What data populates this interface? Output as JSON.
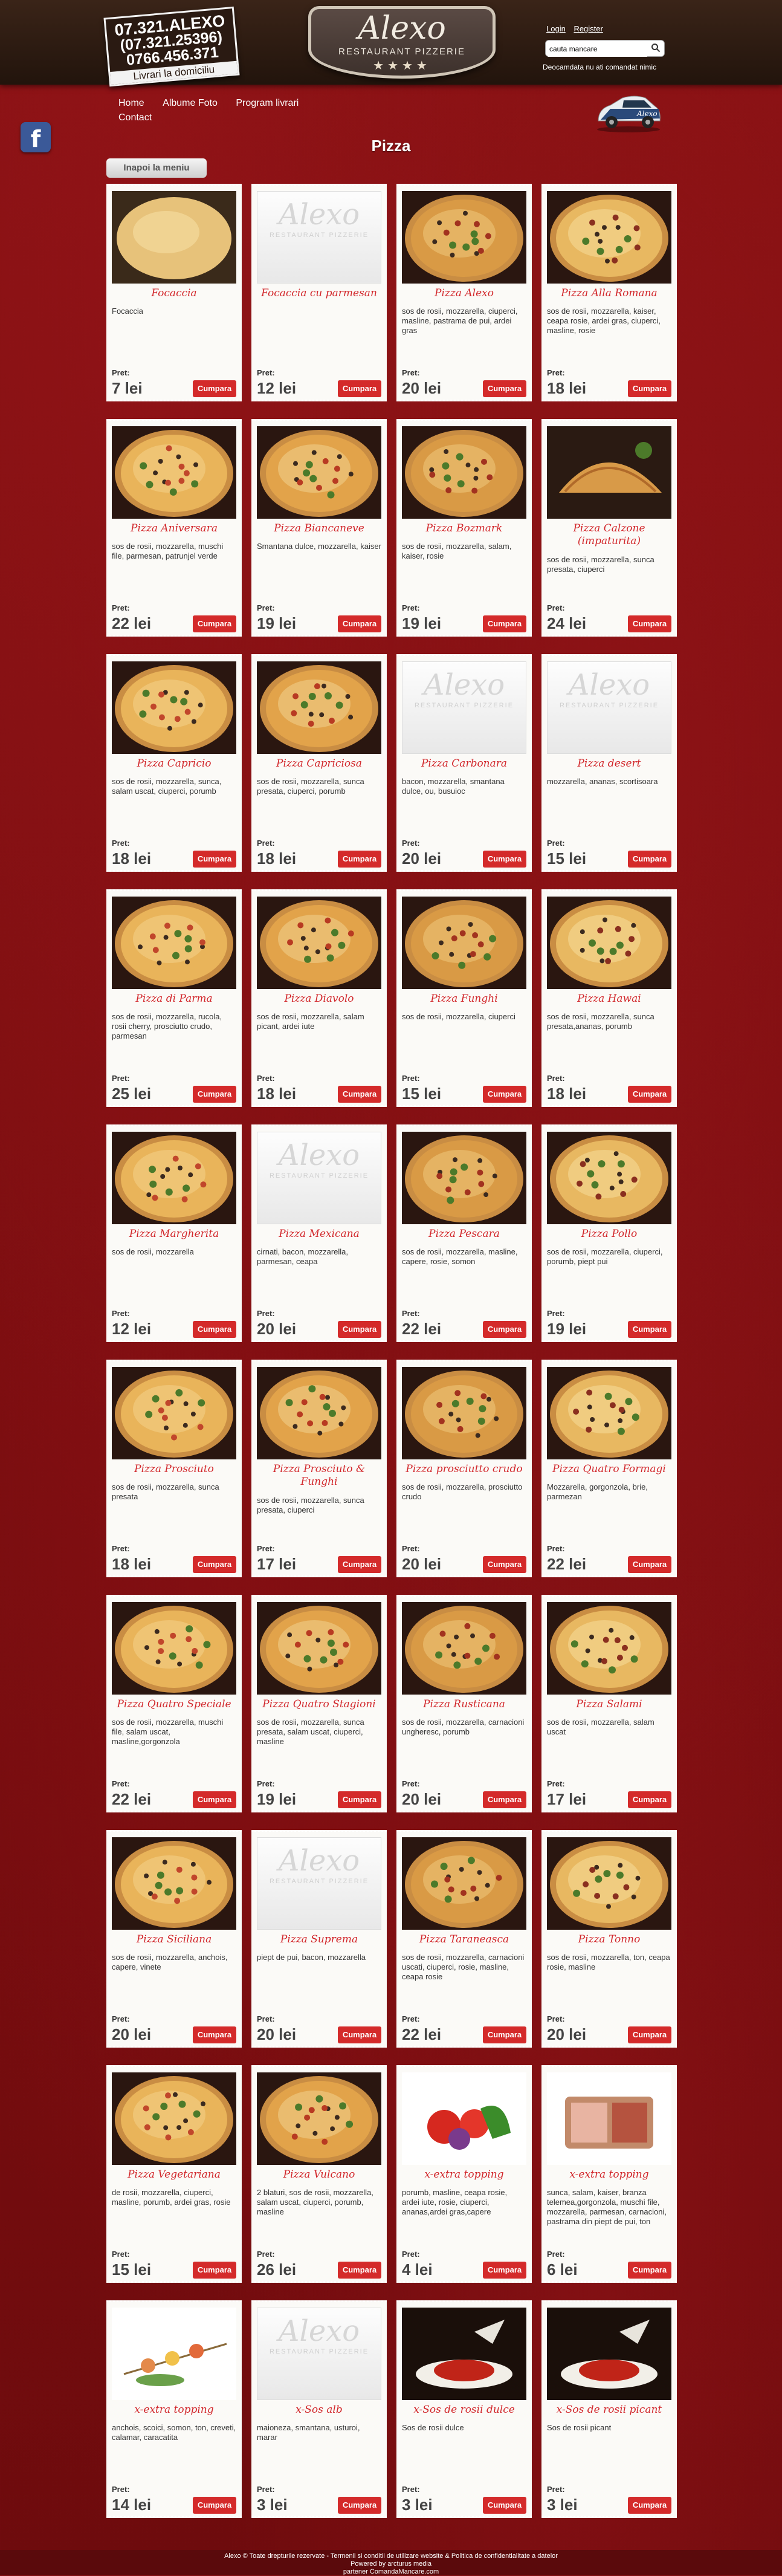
{
  "header": {
    "phone_line1": "07.321.ALEXO",
    "phone_line2": "(07.321.25396)",
    "phone_line3": "0766.456.371",
    "phone_line4": "Livrari la domiciliu",
    "logo_name": "Alexo",
    "logo_sub": "RESTAURANT PIZZERIE",
    "logo_stars": "★★★★",
    "login": "Login",
    "register": "Register",
    "search_value": "cauta mancare",
    "order_status": "Deocamdata nu ati comandat nimic",
    "car_text": "Alexo"
  },
  "nav": [
    "Home",
    "Albume Foto",
    "Program livrari",
    "Contact"
  ],
  "facebook_icon": "f",
  "page_title": "Pizza",
  "back_button": "Inapoi la meniu",
  "price_label": "Pret:",
  "buy_label": "Cumpara",
  "placeholder": {
    "name": "Alexo",
    "sub": "RESTAURANT PIZZERIE"
  },
  "colors": {
    "accent": "#d42a2a",
    "background": "#7a0e10",
    "title_red": "#d2272b"
  },
  "products": [
    {
      "name": "Focaccia",
      "desc": "Focaccia",
      "price": "7 lei",
      "img": "focaccia"
    },
    {
      "name": "Focaccia cu parmesan",
      "desc": "",
      "price": "12 lei",
      "img": "none"
    },
    {
      "name": "Pizza Alexo",
      "desc": "sos de rosii, mozzarella, ciuperci, masline, pastrama de pui, ardei gras",
      "price": "20 lei",
      "img": "pizza"
    },
    {
      "name": "Pizza Alla Romana",
      "desc": "sos de rosii, mozzarella, kaiser, ceapa rosie, ardei gras, ciuperci, masline, rosie",
      "price": "18 lei",
      "img": "pizza"
    },
    {
      "name": "Pizza Aniversara",
      "desc": "sos de rosii, mozzarella, muschi file, parmesan, patrunjel verde",
      "price": "22 lei",
      "img": "pizza"
    },
    {
      "name": "Pizza Biancaneve",
      "desc": "Smantana dulce, mozzarella, kaiser",
      "price": "19 lei",
      "img": "pizza"
    },
    {
      "name": "Pizza Bozmark",
      "desc": "sos de rosii, mozzarella, salam, kaiser, rosie",
      "price": "19 lei",
      "img": "pizza"
    },
    {
      "name": "Pizza Calzone (impaturita)",
      "desc": "sos de rosii, mozzarella, sunca presata, ciuperci",
      "price": "24 lei",
      "img": "calzone"
    },
    {
      "name": "Pizza Capricio",
      "desc": "sos de rosii, mozzarella, sunca, salam uscat, ciuperci, porumb",
      "price": "18 lei",
      "img": "pizza"
    },
    {
      "name": "Pizza Capriciosa",
      "desc": "sos de rosii, mozzarella, sunca presata, ciuperci, porumb",
      "price": "18 lei",
      "img": "pizza"
    },
    {
      "name": "Pizza Carbonara",
      "desc": "bacon, mozzarella, smantana dulce, ou, busuioc",
      "price": "20 lei",
      "img": "none"
    },
    {
      "name": "Pizza desert",
      "desc": "mozzarella, ananas, scortisoara",
      "price": "15 lei",
      "img": "none"
    },
    {
      "name": "Pizza di Parma",
      "desc": "sos de rosii, mozzarella, rucola, rosii cherry, prosciutto crudo, parmesan",
      "price": "25 lei",
      "img": "pizza"
    },
    {
      "name": "Pizza Diavolo",
      "desc": "sos de rosii, mozzarella, salam picant, ardei iute",
      "price": "18 lei",
      "img": "pizza"
    },
    {
      "name": "Pizza Funghi",
      "desc": "sos de rosii, mozzarella, ciuperci",
      "price": "15 lei",
      "img": "pizza"
    },
    {
      "name": "Pizza Hawai",
      "desc": "sos de rosii, mozzarella, sunca presata,ananas, porumb",
      "price": "18 lei",
      "img": "pizza"
    },
    {
      "name": "Pizza Margherita",
      "desc": "sos de rosii, mozzarella",
      "price": "12 lei",
      "img": "pizza"
    },
    {
      "name": "Pizza Mexicana",
      "desc": "cirnati, bacon, mozzarella, parmesan, ceapa",
      "price": "20 lei",
      "img": "none"
    },
    {
      "name": "Pizza Pescara",
      "desc": "sos de rosii, mozzarella, masline, capere, rosie, somon",
      "price": "22 lei",
      "img": "pizza"
    },
    {
      "name": "Pizza Pollo",
      "desc": "sos de rosii, mozzarella, ciuperci, porumb, piept pui",
      "price": "19 lei",
      "img": "pizza"
    },
    {
      "name": "Pizza Prosciuto",
      "desc": "sos de rosii, mozzarella, sunca presata",
      "price": "18 lei",
      "img": "pizza"
    },
    {
      "name": "Pizza Prosciuto & Funghi",
      "desc": "sos de rosii, mozzarella, sunca presata, ciuperci",
      "price": "17 lei",
      "img": "pizza"
    },
    {
      "name": "Pizza prosciutto crudo",
      "desc": "sos de rosii, mozzarella, prosciutto crudo",
      "price": "20 lei",
      "img": "pizza"
    },
    {
      "name": "Pizza Quatro Formagi",
      "desc": "Mozzarella, gorgonzola, brie, parmezan",
      "price": "22 lei",
      "img": "pizza"
    },
    {
      "name": "Pizza Quatro Speciale",
      "desc": "sos de rosii, mozzarella, muschi file, salam uscat, masline,gorgonzola",
      "price": "22 lei",
      "img": "pizza"
    },
    {
      "name": "Pizza Quatro Stagioni",
      "desc": "sos de rosii, mozzarella, sunca presata, salam uscat, ciuperci, masline",
      "price": "19 lei",
      "img": "pizza"
    },
    {
      "name": "Pizza Rusticana",
      "desc": "sos de rosii, mozzarella, carnacioni ungheresc, porumb",
      "price": "20 lei",
      "img": "pizza"
    },
    {
      "name": "Pizza Salami",
      "desc": "sos de rosii, mozzarella, salam uscat",
      "price": "17 lei",
      "img": "pizza"
    },
    {
      "name": "Pizza Siciliana",
      "desc": "sos de rosii, mozzarella, anchois, capere, vinete",
      "price": "20 lei",
      "img": "pizza"
    },
    {
      "name": "Pizza Suprema",
      "desc": "piept de pui, bacon, mozzarella",
      "price": "20 lei",
      "img": "none"
    },
    {
      "name": "Pizza Taraneasca",
      "desc": "sos de rosii, mozzarella, carnacioni uscati, ciuperci, rosie, masline, ceapa rosie",
      "price": "22 lei",
      "img": "pizza"
    },
    {
      "name": "Pizza Tonno",
      "desc": "sos de rosii, mozzarella, ton, ceapa rosie, masline",
      "price": "20 lei",
      "img": "pizza"
    },
    {
      "name": "Pizza Vegetariana",
      "desc": "de rosii, mozzarella, ciuperci, masline, porumb, ardei gras, rosie",
      "price": "15 lei",
      "img": "pizza"
    },
    {
      "name": "Pizza Vulcano",
      "desc": "2 blaturi, sos de rosii, mozzarella, salam uscat, ciuperci, porumb, masline",
      "price": "26 lei",
      "img": "pizza"
    },
    {
      "name": "x-extra topping",
      "desc": "porumb, masline, ceapa rosie, ardei iute, rosie, ciuperci, ananas,ardei gras,capere",
      "price": "4 lei",
      "img": "vegetables"
    },
    {
      "name": "x-extra topping",
      "desc": "sunca, salam, kaiser, branza telemea,gorgonzola, muschi file, mozzarella, parmesan, carnacioni, pastrama din piept de pui, ton",
      "price": "6 lei",
      "img": "meats"
    },
    {
      "name": "x-extra topping",
      "desc": "anchois, scoici, somon, ton, creveti, calamar, caracatita",
      "price": "14 lei",
      "img": "seafood"
    },
    {
      "name": "x-Sos alb",
      "desc": "maioneza, smantana, usturoi, marar",
      "price": "3 lei",
      "img": "none"
    },
    {
      "name": "x-Sos de rosii dulce",
      "desc": "Sos de rosii dulce",
      "price": "3 lei",
      "img": "sauce"
    },
    {
      "name": "x-Sos de rosii picant",
      "desc": "Sos de rosii picant",
      "price": "3 lei",
      "img": "sauce"
    }
  ],
  "footer": {
    "line1": "Alexo © Toate drepturile rezervate - Termenii si conditii de utilizare website & Politica de confidentialitate a datelor",
    "line2": "Powered by arcturus media",
    "line3": "partener ComandaMancare.com"
  }
}
